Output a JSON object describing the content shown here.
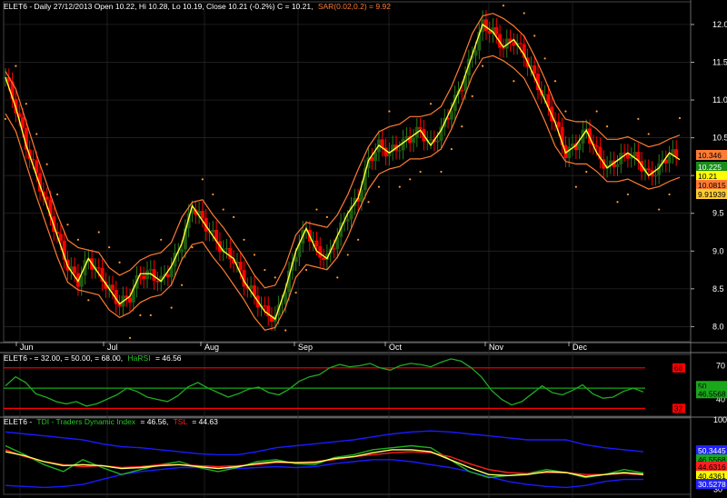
{
  "panes": {
    "price": {
      "ticker": "ELET6",
      "header_main": "ELET6 - Daily 27/12/2013 Open 10.22, Hi 10.28, Lo 10.19, Close 10.21 (-0.2%) C = 10.21,",
      "header_sar": "SAR(0.02,0.2) = 9.92"
    },
    "harsi": {
      "header_main": "ELET6 -  = 32.00,  = 50.00,  = 68.00,",
      "header_ind": "HaRSI",
      "header_val": "= 46.56"
    },
    "tdi": {
      "header_main": "ELET6 -",
      "header_ind": "TDI - Traders Dynamic Index",
      "header_val": "= 46.56,",
      "header_tsl": "TSL",
      "header_tsl_val": "= 44.63"
    }
  },
  "months": [
    "Jun",
    "Jul",
    "Aug",
    "Sep",
    "Oct",
    "Nov",
    "Dec"
  ],
  "colors": {
    "bg": "#000000",
    "grid": "#2a2a2a",
    "up_candle": "#1f5a13",
    "down_candle": "#ff0000",
    "ma_fast": "#ffff33",
    "band": "#ff7b33",
    "sar": "#ff9a33",
    "harsi_line": "#24a824",
    "level_line": "#ff0000",
    "mid_line": "#14a814",
    "tdi_blue": "#1a1aff",
    "tdi_green": "#20b020",
    "tdi_red": "#ff2020",
    "tdi_yellow": "#ffff66"
  },
  "chart_data": [
    {
      "type": "line",
      "pane": "price",
      "ylim": [
        7.8,
        12.3
      ],
      "yticks": [
        "12.0",
        "11.5",
        "11.0",
        "10.5",
        "10.0",
        "9.5",
        "9.0",
        "8.5",
        "8.0"
      ],
      "x_months": [
        "Jun",
        "Jul",
        "Aug",
        "Sep",
        "Oct",
        "Nov",
        "Dec"
      ],
      "close_path": [
        11.3,
        10.9,
        10.4,
        10.0,
        9.6,
        9.2,
        8.8,
        8.6,
        8.9,
        8.7,
        8.5,
        8.3,
        8.4,
        8.7,
        8.7,
        8.6,
        8.8,
        9.1,
        9.6,
        9.4,
        9.2,
        9.0,
        8.9,
        8.6,
        8.4,
        8.2,
        8.1,
        8.5,
        9.0,
        9.3,
        9.0,
        8.9,
        9.2,
        9.5,
        9.7,
        10.2,
        10.4,
        10.3,
        10.4,
        10.5,
        10.6,
        10.4,
        10.6,
        10.9,
        11.2,
        11.6,
        12.0,
        11.9,
        11.7,
        11.8,
        11.6,
        11.3,
        11.0,
        10.7,
        10.3,
        10.4,
        10.6,
        10.3,
        10.1,
        10.2,
        10.3,
        10.2,
        10.0,
        10.1,
        10.3,
        10.21
      ],
      "labels": [
        {
          "text": "10.346",
          "fg": "#000000",
          "bg": "#ff7b33"
        },
        {
          "text": "10.225",
          "fg": "#ffffff",
          "bg": "#1a8c1a"
        },
        {
          "text": "10.21",
          "fg": "#000000",
          "bg": "#ffff00"
        },
        {
          "text": "10.0815",
          "fg": "#000000",
          "bg": "#ff7b33"
        },
        {
          "text": "9.91939",
          "fg": "#000000",
          "bg": "#ffcc33"
        }
      ]
    },
    {
      "type": "line",
      "pane": "harsi",
      "ylim": [
        25,
        80
      ],
      "yticks": [
        "70",
        "50",
        "40"
      ],
      "levels": [
        68,
        50,
        32
      ],
      "level_labels": [
        "68",
        "32"
      ],
      "series": [
        {
          "values": [
            52,
            60,
            55,
            45,
            42,
            38,
            36,
            38,
            34,
            36,
            40,
            44,
            50,
            47,
            42,
            40,
            38,
            43,
            51,
            55,
            50,
            46,
            42,
            45,
            49,
            51,
            46,
            44,
            49,
            56,
            60,
            62,
            68,
            71,
            69,
            70,
            72,
            68,
            66,
            70,
            72,
            71,
            69,
            73,
            76,
            74,
            68,
            60,
            48,
            40,
            35,
            38,
            45,
            52,
            46,
            44,
            48,
            53,
            45,
            41,
            42,
            47,
            50,
            46.56
          ]
        }
      ],
      "labels": [
        {
          "text": "50",
          "fg": "#000000",
          "bg": "#1aa81a"
        },
        {
          "text": "46.5568",
          "fg": "#000000",
          "bg": "#1aa81a"
        }
      ]
    },
    {
      "type": "line",
      "pane": "tdi",
      "ylim": [
        25,
        102
      ],
      "yticks": [
        "100",
        "68",
        "40",
        "30"
      ],
      "series": [
        {
          "values": [
            88,
            86,
            84,
            82,
            80,
            76,
            73,
            72,
            70,
            68,
            66,
            65,
            65,
            68,
            72,
            74,
            76,
            78,
            80,
            83,
            86,
            88,
            89,
            88,
            86,
            84,
            82,
            80,
            80,
            80,
            75,
            72,
            70,
            68
          ]
        },
        {
          "values": [
            34,
            33,
            32,
            33,
            35,
            40,
            45,
            48,
            50,
            52,
            52,
            52,
            51,
            52,
            53,
            52,
            53,
            56,
            58,
            60,
            60,
            58,
            55,
            52,
            48,
            43,
            38,
            35,
            33,
            32,
            34,
            38,
            40,
            40
          ]
        },
        {
          "values": [
            74,
            65,
            55,
            48,
            60,
            52,
            45,
            50,
            55,
            58,
            52,
            48,
            52,
            58,
            60,
            56,
            55,
            62,
            65,
            70,
            72,
            74,
            72,
            60,
            48,
            42,
            44,
            46,
            50,
            47,
            42,
            45,
            50,
            46.56
          ]
        },
        {
          "values": [
            70,
            63,
            58,
            55,
            53,
            54,
            52,
            53,
            55,
            55,
            54,
            53,
            54,
            55,
            57,
            57,
            58,
            60,
            63,
            65,
            67,
            68,
            67,
            63,
            56,
            50,
            47,
            46,
            47,
            47,
            45,
            45,
            46,
            44.63
          ]
        },
        {
          "values": [
            68,
            64,
            58,
            54,
            55,
            54,
            51,
            52,
            54,
            55,
            53,
            51,
            53,
            56,
            58,
            57,
            57,
            61,
            63,
            67,
            70,
            70,
            68,
            60,
            52,
            45,
            44,
            45,
            48,
            47,
            43,
            45,
            47,
            45.2
          ]
        }
      ],
      "labels": [
        {
          "text": "50.3445",
          "fg": "#ffffff",
          "bg": "#2222ff"
        },
        {
          "text": "46.5568",
          "fg": "#000000",
          "bg": "#1aa81a"
        },
        {
          "text": "44.6316",
          "fg": "#000000",
          "bg": "#ff2020"
        },
        {
          "text": "40.4361",
          "fg": "#000000",
          "bg": "#ffff00"
        },
        {
          "text": "30.5278",
          "fg": "#ffffff",
          "bg": "#2222ff"
        }
      ]
    }
  ]
}
